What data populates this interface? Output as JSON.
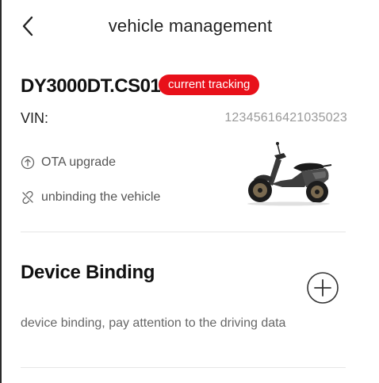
{
  "header": {
    "title": "vehicle management",
    "back_icon": "chevron-left-icon"
  },
  "vehicle": {
    "name": "DY3000DT.CS01",
    "status_badge": "current tracking",
    "vin_label": "VIN:",
    "vin_value": "12345616421035023",
    "image": "scooter-image",
    "actions": [
      {
        "icon": "ota-upgrade-icon",
        "label": "OTA upgrade"
      },
      {
        "icon": "unlink-icon",
        "label": "unbinding the vehicle"
      }
    ]
  },
  "device_binding": {
    "title": "Device Binding",
    "description": "device binding, pay attention to the driving data",
    "add_icon": "plus-circle-icon"
  },
  "colors": {
    "accent": "#e8101a",
    "text_primary": "#111111",
    "text_secondary": "#666666",
    "text_muted": "#9a9a9a",
    "divider": "#e6e6e6"
  }
}
